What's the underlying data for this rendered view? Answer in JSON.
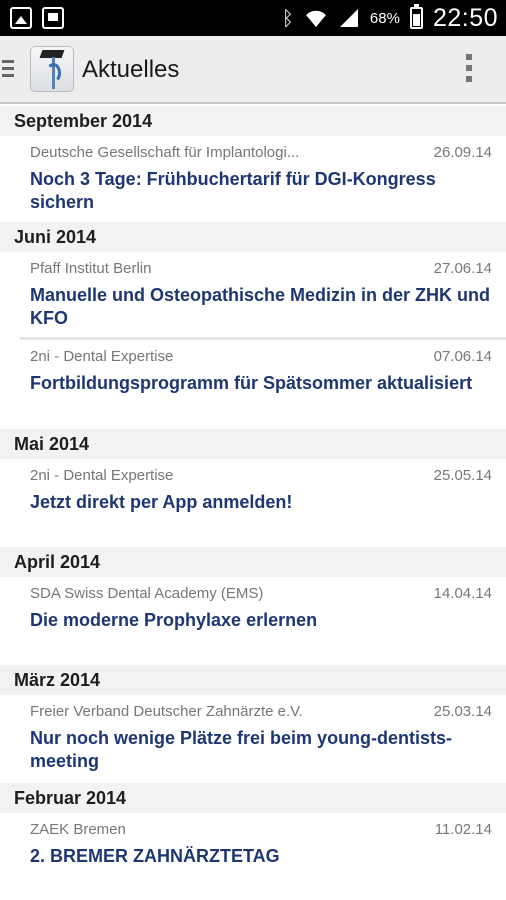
{
  "status_bar": {
    "battery": "68%",
    "time": "22:50",
    "icons": [
      "image-notification-icon",
      "tv-notification-icon",
      "bluetooth-icon",
      "wifi-icon",
      "cell-signal-icon",
      "battery-icon"
    ]
  },
  "action_bar": {
    "title": "Aktuelles",
    "icons": [
      "drawer-menu-icon",
      "app-logo-icon",
      "overflow-menu-icon"
    ]
  },
  "sections": [
    {
      "header": "September 2014",
      "items": [
        {
          "source": "Deutsche Gesellschaft für Implantologi...",
          "date": "26.09.14",
          "title": "Noch 3 Tage: Frühbuchertarif für DGI-Kongress sichern"
        }
      ]
    },
    {
      "header": "Juni 2014",
      "items": [
        {
          "source": "Pfaff Institut Berlin",
          "date": "27.06.14",
          "title": "Manuelle und Osteopathische Medizin in der ZHK und KFO"
        },
        {
          "source": "2ni - Dental Expertise",
          "date": "07.06.14",
          "title": "Fortbildungsprogramm für Spätsommer aktualisiert"
        }
      ]
    },
    {
      "header": "Mai 2014",
      "items": [
        {
          "source": "2ni - Dental Expertise",
          "date": "25.05.14",
          "title": "Jetzt direkt per App anmelden!"
        }
      ]
    },
    {
      "header": "April 2014",
      "items": [
        {
          "source": "SDA Swiss Dental Academy (EMS)",
          "date": "14.04.14",
          "title": "Die moderne Prophylaxe erlernen"
        }
      ]
    },
    {
      "header": "März 2014",
      "items": [
        {
          "source": "Freier Verband Deutscher Zahnärzte e.V.",
          "date": "25.03.14",
          "title": "Nur noch wenige Plätze frei beim young-dentists-meeting"
        }
      ]
    },
    {
      "header": "Februar 2014",
      "items": [
        {
          "source": "ZAEK Bremen",
          "date": "11.02.14",
          "title": "2. BREMER ZAHNÄRZTETAG"
        }
      ]
    }
  ]
}
